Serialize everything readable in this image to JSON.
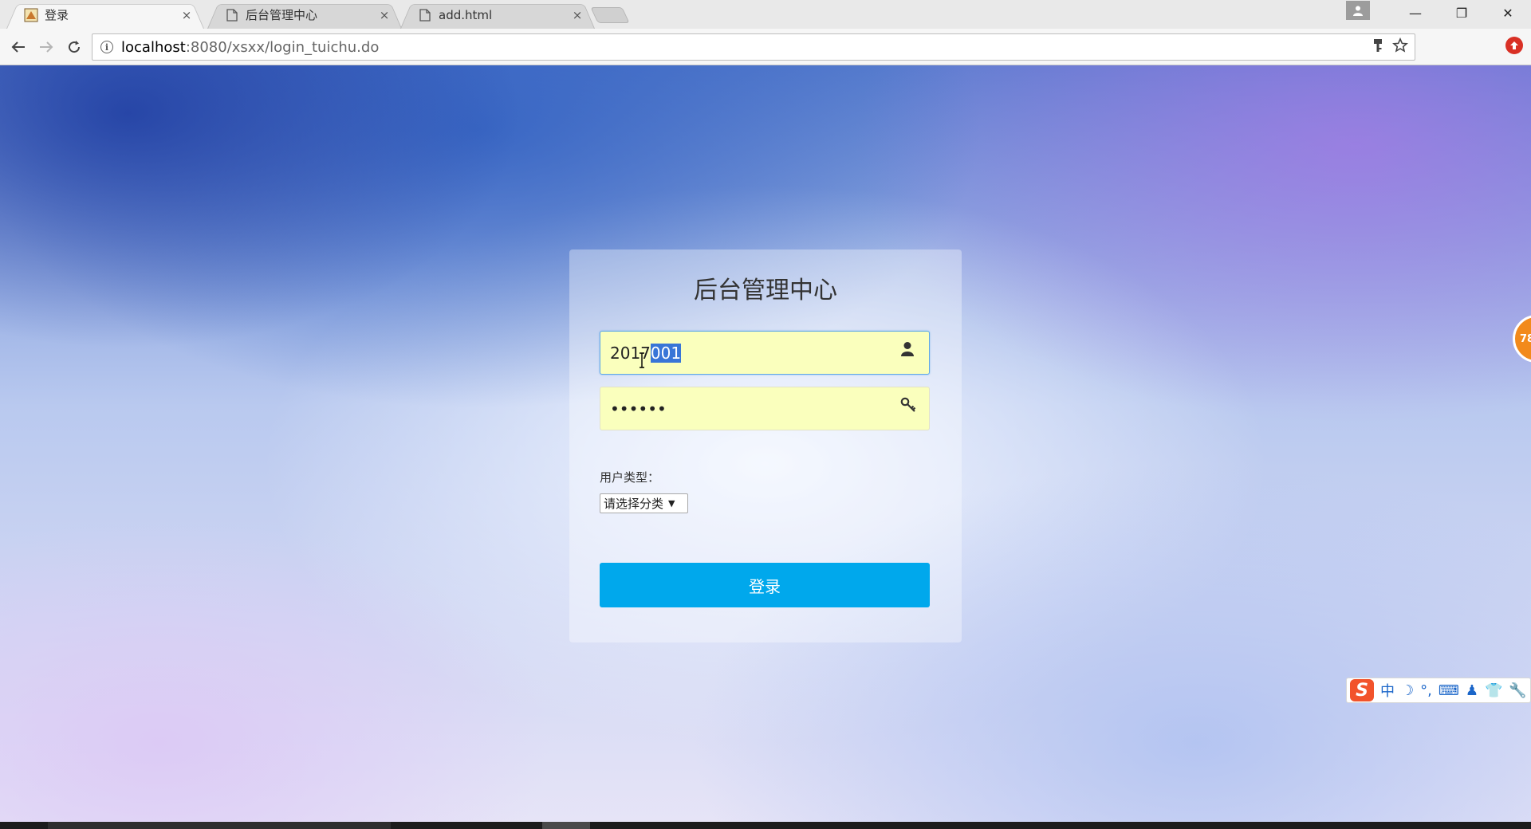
{
  "browser": {
    "tabs": [
      {
        "title": "登录",
        "close": "×"
      },
      {
        "title": "后台管理中心",
        "close": "×"
      },
      {
        "title": "add.html",
        "close": "×"
      }
    ],
    "window_controls": {
      "minimize": "—",
      "restore": "❐",
      "close": "✕"
    },
    "url": {
      "host": "localhost",
      "path": ":8080/xsxx/login_tuichu.do"
    }
  },
  "login": {
    "title": "后台管理中心",
    "username_prefix": "2017",
    "username_selected": "001",
    "password_masked": "••••••",
    "user_type_label": "用户类型：",
    "user_type_selected": "请选择分类",
    "submit_label": "登录"
  },
  "overlays": {
    "side_float_text": "78",
    "ime_items": [
      "中",
      "☽",
      "°,",
      "⌨",
      "♟",
      "👕",
      "🔧"
    ],
    "ime_logo": "S"
  },
  "colors": {
    "accent_button": "#00a8ec",
    "autofill_bg": "#faffbd",
    "selection": "#3875d7"
  }
}
